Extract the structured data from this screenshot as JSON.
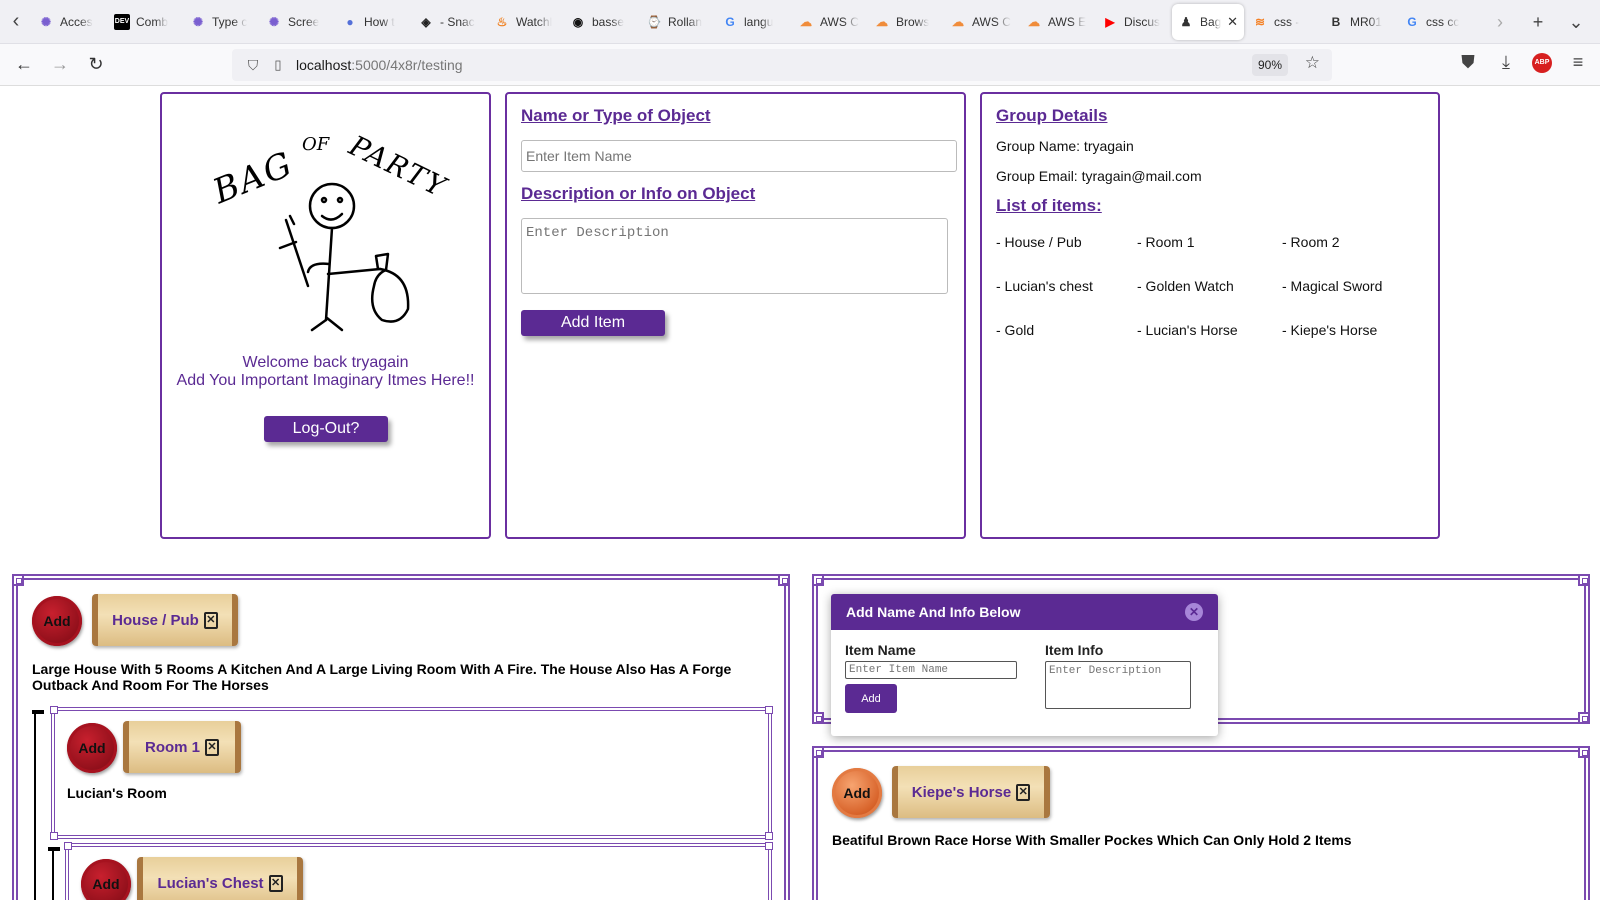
{
  "browser": {
    "tabs": [
      {
        "title": "Acces",
        "icon": "gear-icon",
        "color": "#7a5fd0"
      },
      {
        "title": "Comb",
        "icon": "dev-icon",
        "color": "#000000"
      },
      {
        "title": "Type c",
        "icon": "gear-icon",
        "color": "#7a5fd0"
      },
      {
        "title": "Scree",
        "icon": "gear-icon",
        "color": "#7a5fd0"
      },
      {
        "title": "How t",
        "icon": "dot-icon",
        "color": "#5470d8"
      },
      {
        "title": "- Snac",
        "icon": "cube-icon",
        "color": "#222222"
      },
      {
        "title": "Watchl",
        "icon": "flame-icon",
        "color": "#f0801f"
      },
      {
        "title": "basse",
        "icon": "github-icon",
        "color": "#111111"
      },
      {
        "title": "Rollan",
        "icon": "watch-icon",
        "color": "#444444"
      },
      {
        "title": "langu",
        "icon": "google-icon",
        "color": "#4285f4"
      },
      {
        "title": "AWS C",
        "icon": "cloud-icon",
        "color": "#f08c3a"
      },
      {
        "title": "Brows",
        "icon": "cloud-icon",
        "color": "#f08c3a"
      },
      {
        "title": "AWS C",
        "icon": "cloud-icon",
        "color": "#f08c3a"
      },
      {
        "title": "AWS E",
        "icon": "cloud-icon",
        "color": "#f08c3a"
      },
      {
        "title": "Discus",
        "icon": "youtube-icon",
        "color": "#ff0000"
      },
      {
        "title": "Bag",
        "icon": "bag-icon",
        "color": "#333333",
        "active": true
      },
      {
        "title": "css - ",
        "icon": "stack-icon",
        "color": "#f48024"
      },
      {
        "title": "MR01",
        "icon": "b-icon",
        "color": "#333333"
      },
      {
        "title": "css cc",
        "icon": "google-icon",
        "color": "#4285f4"
      }
    ],
    "url_host": "localhost",
    "url_path": ":5000/4x8r/testing",
    "zoom": "90%"
  },
  "logo": {
    "text_bag": "BAG",
    "text_of": "OF",
    "text_party": "PARTY"
  },
  "welcome": {
    "line1": "Welcome back tryagain",
    "line2": "Add You Important Imaginary Itmes Here!!",
    "logout_label": "Log-Out?"
  },
  "form": {
    "name_heading": "Name or Type of Object",
    "name_placeholder": "Enter Item Name",
    "desc_heading": "Description or Info on Object",
    "desc_placeholder": "Enter Description",
    "add_label": "Add Item"
  },
  "group": {
    "heading": "Group Details",
    "name_line": "Group Name: tryagain",
    "email_line": "Group Email: tyragain@mail.com",
    "list_heading": "List of items:",
    "items": [
      "- House / Pub",
      "- Room 1",
      "- Room 2",
      "- Lucian's chest",
      "- Golden Watch",
      "- Magical Sword",
      "- Gold",
      "- Lucian's Horse",
      "- Kiepe's Horse"
    ]
  },
  "tree": {
    "add_label": "Add",
    "house": {
      "name": "House / Pub",
      "desc": "Large House With 5 Rooms A Kitchen And A Large Living Room With A Fire. The House Also Has A Forge Outback And Room For The Horses"
    },
    "room1": {
      "name": "Room 1",
      "desc": "Lucian's Room"
    },
    "chest": {
      "name": "Lucian's Chest"
    },
    "kiepe": {
      "name": "Kiepe's Horse",
      "desc": "Beatiful Brown Race Horse With Smaller Pockes Which Can Only Hold 2 Items"
    }
  },
  "modal": {
    "title": "Add Name And Info Below",
    "name_label": "Item Name",
    "info_label": "Item Info",
    "name_placeholder": "Enter Item Name",
    "info_placeholder": "Enter Description",
    "add_label": "Add"
  },
  "colors": {
    "brand_purple": "#5b2a93",
    "seal_red": "#a6121f",
    "seal_orange": "#e37a42"
  }
}
